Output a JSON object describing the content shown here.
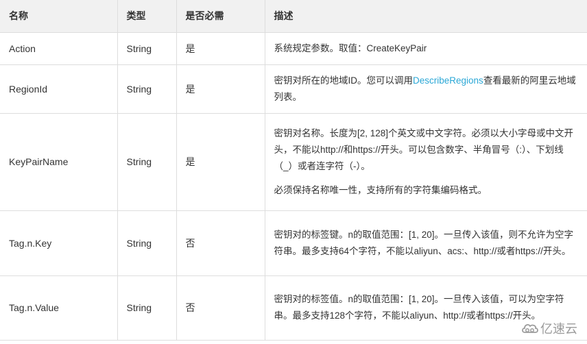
{
  "table": {
    "headers": [
      "名称",
      "类型",
      "是否必需",
      "描述"
    ],
    "rows": [
      {
        "name": "Action",
        "type": "String",
        "required": "是",
        "description": [
          {
            "segments": [
              {
                "text": "系统规定参数。取值：CreateKeyPair"
              }
            ]
          }
        ]
      },
      {
        "name": "RegionId",
        "type": "String",
        "required": "是",
        "description": [
          {
            "segments": [
              {
                "text": "密钥对所在的地域ID。您可以调用"
              },
              {
                "text": "DescribeRegions",
                "link": true
              },
              {
                "text": "查看最新的阿里云地域列表。"
              }
            ]
          }
        ]
      },
      {
        "name": "KeyPairName",
        "type": "String",
        "required": "是",
        "description": [
          {
            "segments": [
              {
                "text": "密钥对名称。长度为[2, 128]个英文或中文字符。必须以大小字母或中文开头，不能以http://和https://开头。可以包含数字、半角冒号（:）、下划线（_）或者连字符（-）。"
              }
            ]
          },
          {
            "segments": [
              {
                "text": "必须保持名称唯一性，支持所有的字符集编码格式。"
              }
            ]
          }
        ]
      },
      {
        "name": "Tag.n.Key",
        "type": "String",
        "required": "否",
        "description": [
          {
            "segments": [
              {
                "text": "密钥对的标签键。n的取值范围：[1, 20]。一旦传入该值，则不允许为空字符串。最多支持64个字符，不能以aliyun、acs:、http://或者https://开头。"
              }
            ]
          }
        ]
      },
      {
        "name": "Tag.n.Value",
        "type": "String",
        "required": "否",
        "description": [
          {
            "segments": [
              {
                "text": "密钥对的标签值。n的取值范围：[1, 20]。一旦传入该值，可以为空字符串。最多支持128个字符，不能以aliyun、http://或者https://开头。"
              }
            ]
          }
        ]
      }
    ]
  },
  "watermark": {
    "icon": "cloud-logo-icon",
    "text": "亿速云"
  },
  "colors": {
    "link": "#2aa7d6",
    "header_bg": "#f1f1f1",
    "border": "#dddddd",
    "text": "#333333"
  }
}
